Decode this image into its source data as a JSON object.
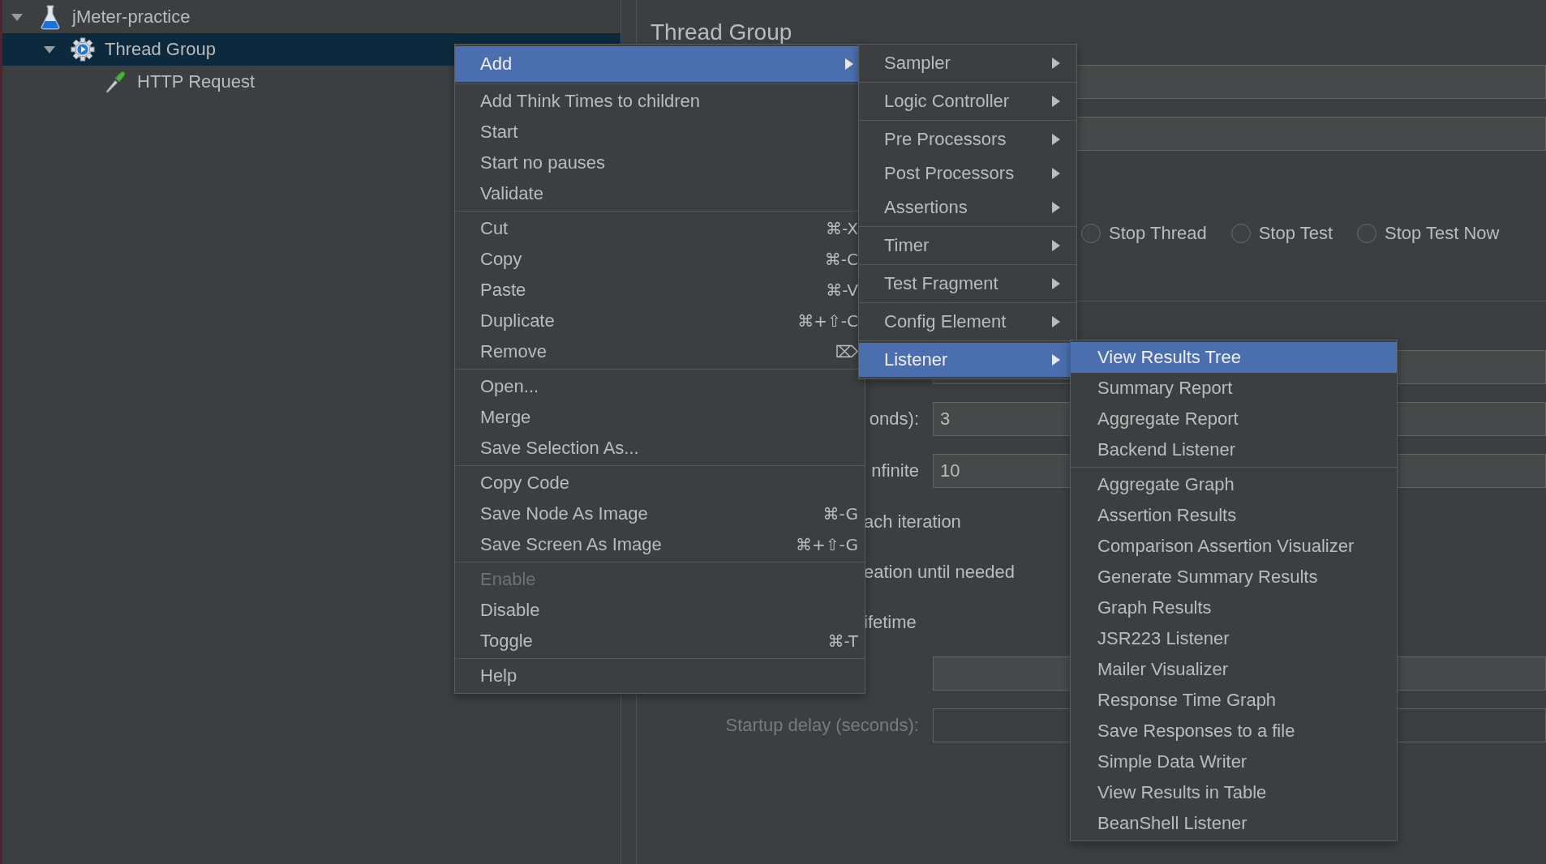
{
  "tree": [
    {
      "label": "jMeter-practice",
      "kind": "test-plan",
      "expanded": true,
      "selected": false,
      "children": [
        {
          "label": "Thread Group",
          "kind": "thread-group",
          "expanded": true,
          "selected": true,
          "children": [
            {
              "label": "HTTP Request",
              "kind": "sampler",
              "selected": false
            }
          ]
        }
      ]
    }
  ],
  "form": {
    "title": "Thread Group",
    "rows": [
      {
        "kind": "field"
      },
      {
        "kind": "field"
      },
      {
        "kind": "radios",
        "options": [
          {
            "label": "Stop Thread",
            "selected": false
          },
          {
            "label": "Stop Test",
            "selected": false
          },
          {
            "label": "Stop Test Now",
            "selected": false
          }
        ]
      },
      {
        "kind": "field"
      },
      {
        "kind": "labeled-field",
        "label": "onds):",
        "value": "3",
        "disabled": false
      },
      {
        "kind": "labeled-field",
        "label": "nfinite",
        "value": "10",
        "disabled": false
      },
      {
        "kind": "text",
        "label": "ach iteration"
      },
      {
        "kind": "text",
        "label": "eation until needed"
      },
      {
        "kind": "text",
        "label": "ifetime"
      },
      {
        "kind": "field"
      },
      {
        "kind": "labeled-field",
        "label": "Startup delay (seconds):",
        "disabled": true
      }
    ]
  },
  "menus": [
    {
      "groups": [
        [
          {
            "label": "Add",
            "submenu": true,
            "selected": true,
            "disabled": false
          }
        ],
        [
          {
            "label": "Add Think Times to children",
            "selected": false,
            "disabled": false
          },
          {
            "label": "Start",
            "selected": false,
            "disabled": false
          },
          {
            "label": "Start no pauses",
            "selected": false,
            "disabled": false
          },
          {
            "label": "Validate",
            "selected": false,
            "disabled": false
          }
        ],
        [
          {
            "label": "Cut",
            "shortcut": "⌘-X",
            "selected": false,
            "disabled": false
          },
          {
            "label": "Copy",
            "shortcut": "⌘-C",
            "selected": false,
            "disabled": false
          },
          {
            "label": "Paste",
            "shortcut": "⌘-V",
            "selected": false,
            "disabled": false
          },
          {
            "label": "Duplicate",
            "shortcut": "⌘+⇧-C",
            "selected": false,
            "disabled": false
          },
          {
            "label": "Remove",
            "shortcut": "⌦",
            "selected": false,
            "disabled": false
          }
        ],
        [
          {
            "label": "Open...",
            "selected": false,
            "disabled": false
          },
          {
            "label": "Merge",
            "selected": false,
            "disabled": false
          },
          {
            "label": "Save Selection As...",
            "selected": false,
            "disabled": false
          }
        ],
        [
          {
            "label": "Copy Code",
            "selected": false,
            "disabled": false
          },
          {
            "label": "Save Node As Image",
            "shortcut": "⌘-G",
            "selected": false,
            "disabled": false
          },
          {
            "label": "Save Screen As Image",
            "shortcut": "⌘+⇧-G",
            "selected": false,
            "disabled": false
          }
        ],
        [
          {
            "label": "Enable",
            "selected": false,
            "disabled": true
          },
          {
            "label": "Disable",
            "selected": false,
            "disabled": false
          },
          {
            "label": "Toggle",
            "shortcut": "⌘-T",
            "selected": false,
            "disabled": false
          }
        ],
        [
          {
            "label": "Help",
            "selected": false,
            "disabled": false
          }
        ]
      ]
    },
    {
      "groups": [
        [
          {
            "label": "Sampler",
            "submenu": true,
            "selected": false
          }
        ],
        [
          {
            "label": "Logic Controller",
            "submenu": true,
            "selected": false
          }
        ],
        [
          {
            "label": "Pre Processors",
            "submenu": true,
            "selected": false
          },
          {
            "label": "Post Processors",
            "submenu": true,
            "selected": false
          },
          {
            "label": "Assertions",
            "submenu": true,
            "selected": false
          }
        ],
        [
          {
            "label": "Timer",
            "submenu": true,
            "selected": false
          }
        ],
        [
          {
            "label": "Test Fragment",
            "submenu": true,
            "selected": false
          }
        ],
        [
          {
            "label": "Config Element",
            "submenu": true,
            "selected": false
          }
        ],
        [
          {
            "label": "Listener",
            "submenu": true,
            "selected": true
          }
        ]
      ]
    },
    {
      "groups": [
        [
          {
            "label": "View Results Tree",
            "selected": true
          },
          {
            "label": "Summary Report",
            "selected": false
          },
          {
            "label": "Aggregate Report",
            "selected": false
          },
          {
            "label": "Backend Listener",
            "selected": false
          }
        ],
        [
          {
            "label": "Aggregate Graph",
            "selected": false
          },
          {
            "label": "Assertion Results",
            "selected": false
          },
          {
            "label": "Comparison Assertion Visualizer",
            "selected": false
          },
          {
            "label": "Generate Summary Results",
            "selected": false
          },
          {
            "label": "Graph Results",
            "selected": false
          },
          {
            "label": "JSR223 Listener",
            "selected": false
          },
          {
            "label": "Mailer Visualizer",
            "selected": false
          },
          {
            "label": "Response Time Graph",
            "selected": false
          },
          {
            "label": "Save Responses to a file",
            "selected": false
          },
          {
            "label": "Simple Data Writer",
            "selected": false
          },
          {
            "label": "View Results in Table",
            "selected": false
          },
          {
            "label": "BeanShell Listener",
            "selected": false
          }
        ]
      ]
    }
  ]
}
